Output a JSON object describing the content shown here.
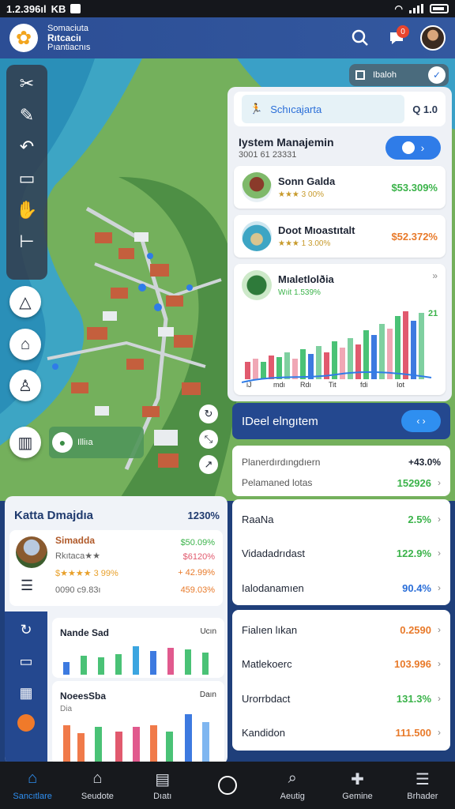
{
  "status_bar": {
    "time": "1.2.396ıl",
    "carrier": "KB"
  },
  "header": {
    "brand_line1": "Somaciuta",
    "brand_line2": "Rıtcaciı",
    "brand_line3": "Pıantiacnıs",
    "notification_count": "0"
  },
  "map": {
    "layer_label": "Ibaloh",
    "chip_label": "Illiıa"
  },
  "right_panel": {
    "search_label": "Schıcajarta",
    "search_count": "Q 1.0",
    "title": "Iystem Manajemin",
    "subtitle": "3001 61 23331",
    "cards": [
      {
        "name": "Sonn Galda",
        "meta": "★★★ 3 00%",
        "value": "$53.309%",
        "value_color": "#3bb34a"
      },
      {
        "name": "Doot Mıoastıtalt",
        "meta": "★★★ 1 3.00%",
        "value": "$52.372%",
        "value_color": "#e87a2a"
      }
    ],
    "chart_card": {
      "name": "Mıaletlolðia",
      "meta": "Wıit 1.539%",
      "corner_value": "21",
      "tick_labels": [
        "iJ",
        "mdı",
        "Rdı",
        "Tit",
        "fdi",
        "Iot"
      ]
    }
  },
  "promo": {
    "label": "IDeel elngıtem"
  },
  "right_lists": [
    {
      "rows": [
        {
          "label": "Planerdırdıngdıern",
          "value": "+43.0%",
          "value_color": "#1d2433"
        },
        {
          "label": "Pelamaned lotas",
          "value": "152926",
          "value_color": "#3bb34a"
        }
      ]
    },
    {
      "rows": [
        {
          "label": "RaaNa",
          "value": "2.5%",
          "value_color": "#3bb34a"
        },
        {
          "label": "Vidadadrıdast",
          "value": "122.9%",
          "value_color": "#3bb34a"
        },
        {
          "label": "Ialodanamıen",
          "value": "90.4%",
          "value_color": "#2a6ed8"
        }
      ]
    },
    {
      "rows": [
        {
          "label": "Fialıen lıkan",
          "value": "0.2590",
          "value_color": "#e87a2a"
        },
        {
          "label": "Matlekoerc",
          "value": "103.996",
          "value_color": "#e87a2a"
        },
        {
          "label": "Urorrbdact",
          "value": "131.3%",
          "value_color": "#3bb34a"
        },
        {
          "label": "Kandidon",
          "value": "111.500",
          "value_color": "#e87a2a"
        }
      ]
    }
  ],
  "left_panel": {
    "title": "Katta Dmajdıa",
    "value": "1230%",
    "card": {
      "name": "Simadda",
      "line2": "Rkıtaca★★",
      "line3": "$★★★★ 3 99%",
      "line4": "0090 c9.83ı",
      "value1": "$50.09%",
      "value2": "$6120%",
      "value3": "+ 42.99%",
      "value4": "459.03%"
    },
    "mini_charts": [
      {
        "title": "Nande Sad",
        "right": "Ucın"
      },
      {
        "title": "NoeesSba",
        "right": "Daın",
        "subtitle": "Dia"
      }
    ]
  },
  "bottom_nav": {
    "items": [
      {
        "label": "Sancıtlare",
        "icon": "map-icon"
      },
      {
        "label": "Seudote",
        "icon": "home-icon"
      },
      {
        "label": "Dıatı",
        "icon": "briefcase-icon"
      },
      {
        "label": "Aeutig",
        "icon": "search-icon"
      },
      {
        "label": "Gemine",
        "icon": "puzzle-icon"
      },
      {
        "label": "Brhader",
        "icon": "menu-icon"
      }
    ]
  }
}
